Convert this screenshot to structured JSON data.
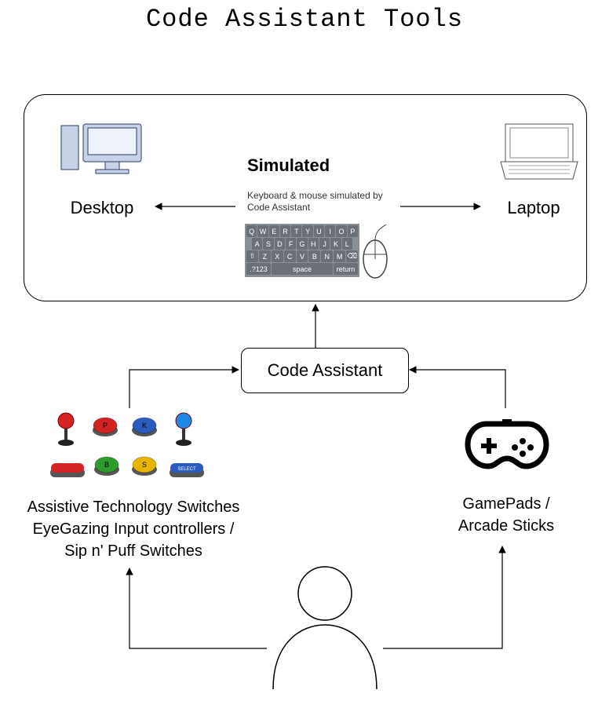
{
  "title": "Code Assistant Tools",
  "panel": {
    "desktop_label": "Desktop",
    "laptop_label": "Laptop",
    "simulated_title": "Simulated",
    "simulated_subtitle": "Keyboard & mouse simulated by Code Assistant"
  },
  "code_assistant_label": "Code Assistant",
  "assistive": {
    "line1": "Assistive Technology Switches",
    "line2": "EyeGazing Input controllers /",
    "line3": "Sip n' Puff Switches"
  },
  "gamepad": {
    "line1": "GamePads /",
    "line2": "Arcade Sticks"
  },
  "keyboard": {
    "row1": [
      "Q",
      "W",
      "E",
      "R",
      "T",
      "Y",
      "U",
      "I",
      "O",
      "P"
    ],
    "row2": [
      "A",
      "S",
      "D",
      "F",
      "G",
      "H",
      "J",
      "K",
      "L"
    ],
    "row3": [
      "⇧",
      "Z",
      "X",
      "C",
      "V",
      "B",
      "N",
      "M",
      "⌫"
    ],
    "row4_left": ".?123",
    "row4_space": "space",
    "row4_right": "return"
  },
  "arcade_buttons": {
    "top": [
      {
        "color": "#d32222"
      },
      {
        "label": "P",
        "color": "#d32222"
      },
      {
        "label": "K",
        "color": "#2a5cbf"
      },
      {
        "color": "#1e88e5"
      }
    ],
    "bottom": [
      {
        "color": "#d32222"
      },
      {
        "label": "B",
        "color": "#2e9b2e"
      },
      {
        "label": "S",
        "color": "#e8b400"
      },
      {
        "label": "SELECT",
        "color": "#2a5cbf"
      }
    ]
  },
  "flow_edges": [
    {
      "from": "user",
      "to": "assistive_switches"
    },
    {
      "from": "user",
      "to": "gamepads"
    },
    {
      "from": "assistive_switches",
      "to": "code_assistant"
    },
    {
      "from": "gamepads",
      "to": "code_assistant"
    },
    {
      "from": "code_assistant",
      "to": "simulated_kbm"
    },
    {
      "from": "simulated_kbm",
      "to": "desktop"
    },
    {
      "from": "simulated_kbm",
      "to": "laptop"
    }
  ]
}
